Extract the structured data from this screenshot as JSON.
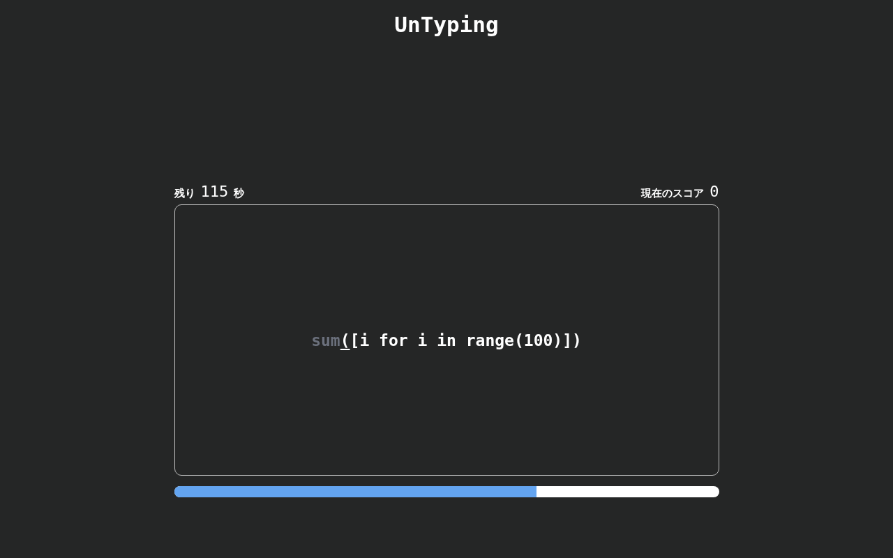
{
  "app_title": "UnTyping",
  "timer": {
    "label": "残り",
    "value": "115",
    "unit": "秒"
  },
  "score": {
    "label": "現在のスコア",
    "value": "0"
  },
  "prompt": {
    "typed": "sum",
    "current": "(",
    "remaining": "[i for i in range(100)])"
  },
  "progress": {
    "level": 0.665
  }
}
